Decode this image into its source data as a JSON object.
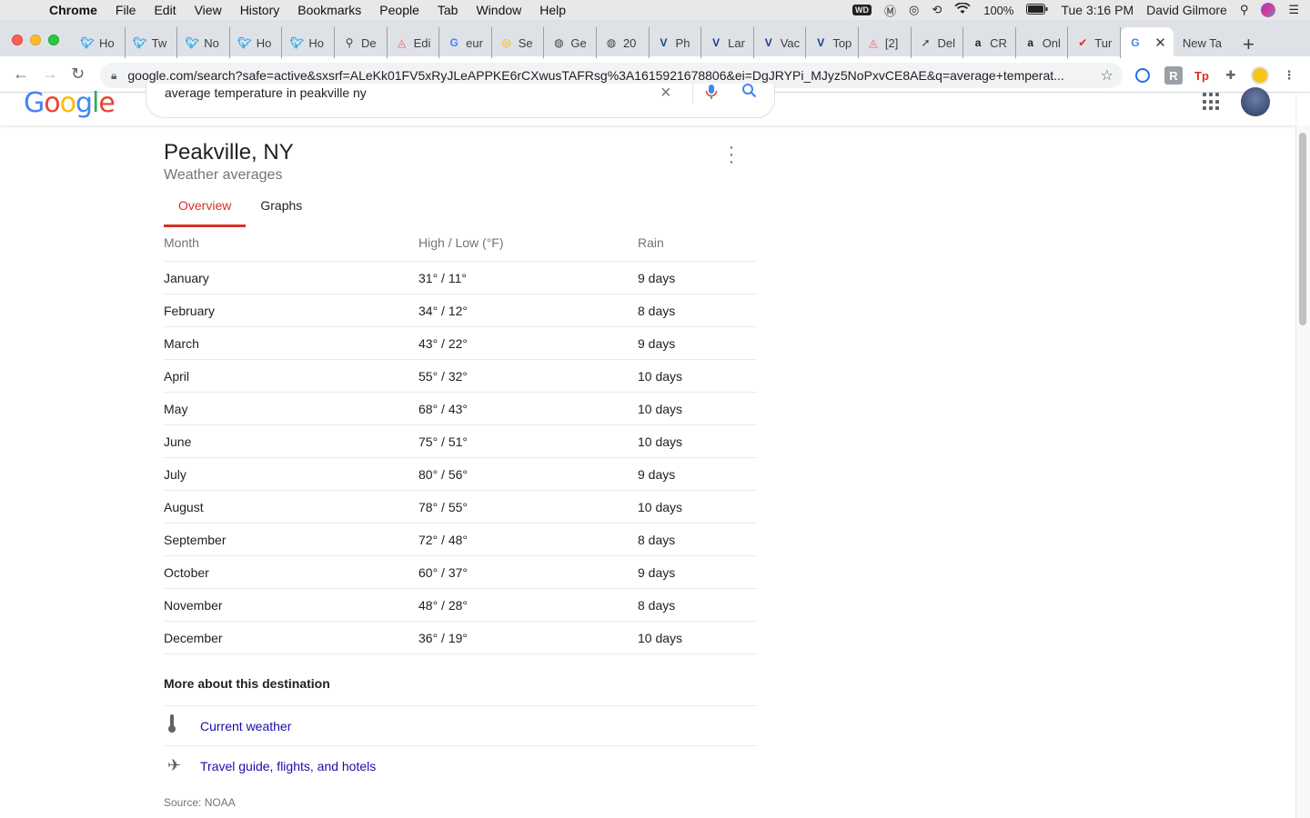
{
  "menubar": {
    "items": [
      "Chrome",
      "File",
      "Edit",
      "View",
      "History",
      "Bookmarks",
      "People",
      "Tab",
      "Window",
      "Help"
    ],
    "wd_badge": "WD",
    "battery": "100%",
    "clock": "Tue 3:16 PM",
    "user": "David Gilmore"
  },
  "tabs": [
    {
      "icon": "twitter-icon",
      "label": "Ho"
    },
    {
      "icon": "twitter-icon",
      "label": "Tw"
    },
    {
      "icon": "twitter-icon",
      "label": "No"
    },
    {
      "icon": "twitter-icon",
      "label": "Ho"
    },
    {
      "icon": "twitter-icon",
      "label": "Ho"
    },
    {
      "icon": "link-icon",
      "label": "De"
    },
    {
      "icon": "airbnb-icon",
      "label": "Edi"
    },
    {
      "icon": "google-icon",
      "label": "eur"
    },
    {
      "icon": "compass-icon",
      "label": "Se"
    },
    {
      "icon": "globe-icon",
      "label": "Ge"
    },
    {
      "icon": "globe-icon",
      "label": "20"
    },
    {
      "icon": "v-icon",
      "label": "Ph"
    },
    {
      "icon": "v-icon",
      "label": "Lar"
    },
    {
      "icon": "v-icon",
      "label": "Vac"
    },
    {
      "icon": "v-icon",
      "label": "Top"
    },
    {
      "icon": "airbnb-icon",
      "label": "[2]"
    },
    {
      "icon": "cursor-icon",
      "label": "Del"
    },
    {
      "icon": "amazon-icon",
      "label": "CR"
    },
    {
      "icon": "amazon-icon",
      "label": "Onl"
    },
    {
      "icon": "check-icon",
      "label": "Tur"
    }
  ],
  "active_tab": {
    "icon": "google-icon"
  },
  "new_tab_label": "New Ta",
  "omnibox": {
    "url": "google.com/search?safe=active&sxsrf=ALeKk01FV5xRyJLeAPPKE6rCXwusTAFRsg%3A1615921678806&ei=DgJRYPi_MJyz5NoPxvCE8AE&q=average+temperat..."
  },
  "search": {
    "query": "average temperature in peakville ny"
  },
  "weather": {
    "title": "Peakville, NY",
    "subtitle": "Weather averages",
    "tabs": [
      "Overview",
      "Graphs"
    ],
    "columns": [
      "Month",
      "High / Low (°F)",
      "Rain"
    ],
    "rows": [
      {
        "month": "January",
        "temp": "31° / 11°",
        "rain": "9 days"
      },
      {
        "month": "February",
        "temp": "34° / 12°",
        "rain": "8 days"
      },
      {
        "month": "March",
        "temp": "43° / 22°",
        "rain": "9 days"
      },
      {
        "month": "April",
        "temp": "55° / 32°",
        "rain": "10 days"
      },
      {
        "month": "May",
        "temp": "68° / 43°",
        "rain": "10 days"
      },
      {
        "month": "June",
        "temp": "75° / 51°",
        "rain": "10 days"
      },
      {
        "month": "July",
        "temp": "80° / 56°",
        "rain": "9 days"
      },
      {
        "month": "August",
        "temp": "78° / 55°",
        "rain": "10 days"
      },
      {
        "month": "September",
        "temp": "72° / 48°",
        "rain": "8 days"
      },
      {
        "month": "October",
        "temp": "60° / 37°",
        "rain": "9 days"
      },
      {
        "month": "November",
        "temp": "48° / 28°",
        "rain": "8 days"
      },
      {
        "month": "December",
        "temp": "36° / 19°",
        "rain": "10 days"
      }
    ],
    "more_title": "More about this destination",
    "links": [
      {
        "icon": "thermometer-icon",
        "label": "Current weather"
      },
      {
        "icon": "airplane-icon",
        "label": "Travel guide, flights, and hotels"
      }
    ],
    "source": "Source: NOAA"
  },
  "colors": {
    "accent_red": "#d93025",
    "link": "#1a0dab",
    "muted": "#70757a"
  }
}
